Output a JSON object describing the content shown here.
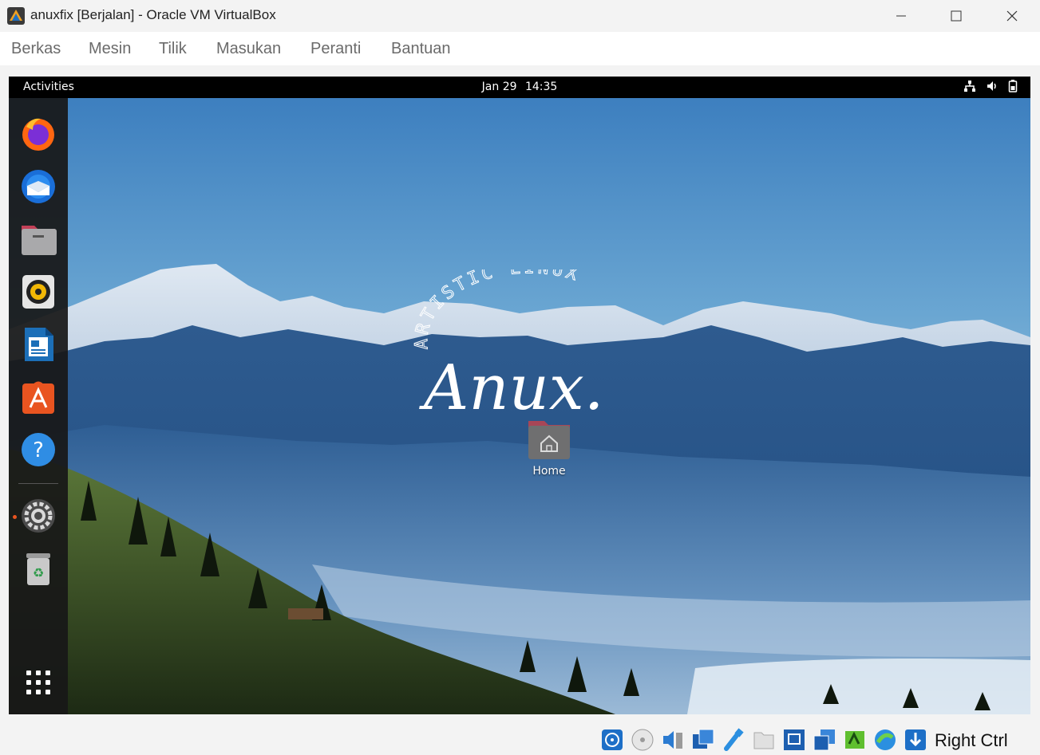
{
  "window": {
    "title": "anuxfix [Berjalan] - Oracle VM VirtualBox",
    "controls": {
      "minimize": "minimize",
      "maximize": "maximize",
      "close": "close"
    }
  },
  "menubar": {
    "items": [
      "Berkas",
      "Mesin",
      "Tilik",
      "Masukan",
      "Peranti",
      "Bantuan"
    ]
  },
  "guest": {
    "topbar": {
      "activities": "Activities",
      "date": "Jan 29",
      "time": "14:35",
      "tray_icons": [
        "network-icon",
        "volume-icon",
        "battery-icon"
      ]
    },
    "dock": {
      "items": [
        {
          "name": "firefox-icon"
        },
        {
          "name": "thunderbird-icon"
        },
        {
          "name": "files-icon"
        },
        {
          "name": "rhythmbox-icon"
        },
        {
          "name": "libreoffice-writer-icon"
        },
        {
          "name": "software-center-icon"
        },
        {
          "name": "help-icon"
        },
        {
          "name": "settings-icon"
        },
        {
          "name": "trash-icon"
        },
        {
          "name": "show-applications-icon"
        }
      ]
    },
    "desktop": {
      "logo_arc_text": "ARTISTIC LINUX",
      "logo_script_text": "Anux.",
      "home_label": "Home"
    }
  },
  "statusbar": {
    "icons": [
      "hard-disk-icon",
      "optical-drive-icon",
      "audio-icon",
      "network-adapter-icon",
      "usb-icon",
      "shared-folders-icon",
      "display-icon",
      "video-capture-icon",
      "recording-icon",
      "guest-additions-icon",
      "keyboard-capture-icon"
    ],
    "host_key": "Right Ctrl"
  }
}
